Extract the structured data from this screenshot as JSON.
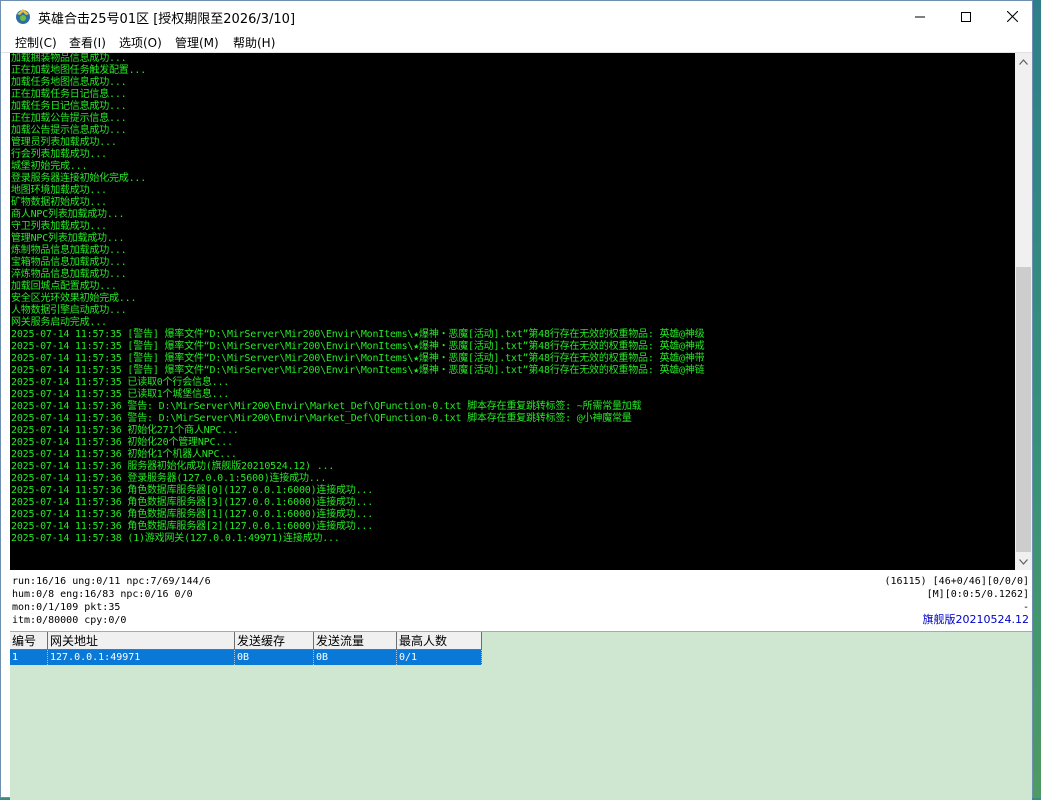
{
  "window": {
    "title": "英雄合击25号01区 [授权期限至2026/3/10]",
    "icon": "app-icon",
    "controls": {
      "minimize": "minimize-icon",
      "maximize": "maximize-icon",
      "close": "close-icon"
    }
  },
  "menu": [
    {
      "label": "控制(C)"
    },
    {
      "label": "查看(I)"
    },
    {
      "label": "选项(O)"
    },
    {
      "label": "管理(M)"
    },
    {
      "label": "帮助(H)"
    }
  ],
  "console": {
    "text_color": "#26e826",
    "background": "#000000",
    "lines": [
      "加载捆装物品信息成功...",
      "正在加载地图任务触发配置...",
      "加载任务地图信息成功...",
      "正在加载任务日记信息...",
      "加载任务日记信息成功...",
      "正在加载公告提示信息...",
      "加载公告提示信息成功...",
      "管理员列表加载成功...",
      "行会列表加载成功...",
      "城堡初始完成...",
      "登录服务器连接初始化完成...",
      "地图环境加载成功...",
      "矿物数据初始成功...",
      "商人NPC列表加载成功...",
      "守卫列表加载成功...",
      "管理NPC列表加载成功...",
      "炼制物品信息加载成功...",
      "宝箱物品信息加载成功...",
      "淬炼物品信息加载成功...",
      "加载回城点配置成功...",
      "安全区光环效果初始完成...",
      "人物数据引擎启动成功...",
      "网关服务启动完成...",
      "2025-07-14 11:57:35 [警告] 爆率文件“D:\\MirServer\\Mir200\\Envir\\MonItems\\★爆神・恶魔[活动].txt”第48行存在无效的权重物品: 英雄@神级",
      "2025-07-14 11:57:35 [警告] 爆率文件“D:\\MirServer\\Mir200\\Envir\\MonItems\\★爆神・恶魔[活动].txt”第48行存在无效的权重物品: 英雄@神戒",
      "2025-07-14 11:57:35 [警告] 爆率文件“D:\\MirServer\\Mir200\\Envir\\MonItems\\★爆神・恶魔[活动].txt”第48行存在无效的权重物品: 英雄@神带",
      "2025-07-14 11:57:35 [警告] 爆率文件“D:\\MirServer\\Mir200\\Envir\\MonItems\\★爆神・恶魔[活动].txt”第48行存在无效的权重物品: 英雄@神链",
      "2025-07-14 11:57:35 已读取0个行会信息...",
      "2025-07-14 11:57:35 已读取1个城堡信息...",
      "2025-07-14 11:57:36 警告: D:\\MirServer\\Mir200\\Envir\\Market_Def\\QFunction-0.txt 脚本存在重复跳转标签: ~所需常量加载",
      "2025-07-14 11:57:36 警告: D:\\MirServer\\Mir200\\Envir\\Market_Def\\QFunction-0.txt 脚本存在重复跳转标签: @小神魔常量",
      "2025-07-14 11:57:36 初始化271个商人NPC...",
      "2025-07-14 11:57:36 初始化20个管理NPC...",
      "2025-07-14 11:57:36 初始化1个机器人NPC...",
      "2025-07-14 11:57:36 服务器初始化成功(旗舰版20210524.12) ...",
      "2025-07-14 11:57:36 登录服务器(127.0.0.1:5600)连接成功...",
      "2025-07-14 11:57:36 角色数据库服务器[0](127.0.0.1:6000)连接成功...",
      "2025-07-14 11:57:36 角色数据库服务器[3](127.0.0.1:6000)连接成功...",
      "2025-07-14 11:57:36 角色数据库服务器[1](127.0.0.1:6000)连接成功...",
      "2025-07-14 11:57:36 角色数据库服务器[2](127.0.0.1:6000)连接成功...",
      "2025-07-14 11:57:38 (1)游戏网关(127.0.0.1:49971)连接成功..."
    ]
  },
  "status": {
    "left": [
      "run:16/16 ung:0/11 npc:7/69/144/6",
      "hum:0/8 eng:16/83 npc:0/16 0/0",
      "mon:0/1/109 pkt:35",
      "itm:0/80000 cpy:0/0"
    ],
    "right": [
      "(16115) [46+0/46][0/0/0]",
      "[M][0:0:5/0.1262]",
      "-",
      "旗舰版20210524.12"
    ],
    "version_color": "#0000c8"
  },
  "gateway_table": {
    "headers": [
      "编号",
      "网关地址",
      "发送缓存",
      "发送流量",
      "最高人数"
    ],
    "rows": [
      [
        "1",
        "127.0.0.1:49971",
        "0B",
        "0B",
        "0/1"
      ]
    ],
    "selected_color": "#0a78d7"
  }
}
